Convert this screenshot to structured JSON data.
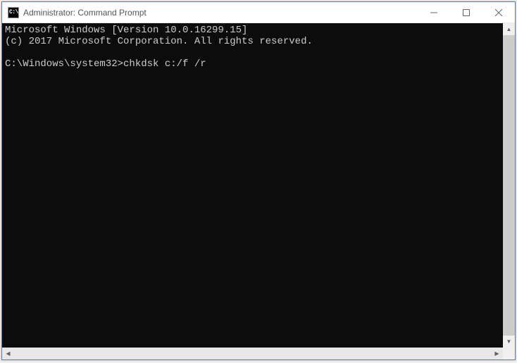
{
  "window": {
    "title": "Administrator: Command Prompt",
    "icon_label": "C:\\."
  },
  "terminal": {
    "line1": "Microsoft Windows [Version 10.0.16299.15]",
    "line2": "(c) 2017 Microsoft Corporation. All rights reserved.",
    "blank": "",
    "prompt": "C:\\Windows\\system32>",
    "command": "chkdsk c:/f /r"
  },
  "colors": {
    "terminal_bg": "#0c0c0c",
    "terminal_fg": "#cccccc",
    "window_border": "#5c7ea6"
  }
}
